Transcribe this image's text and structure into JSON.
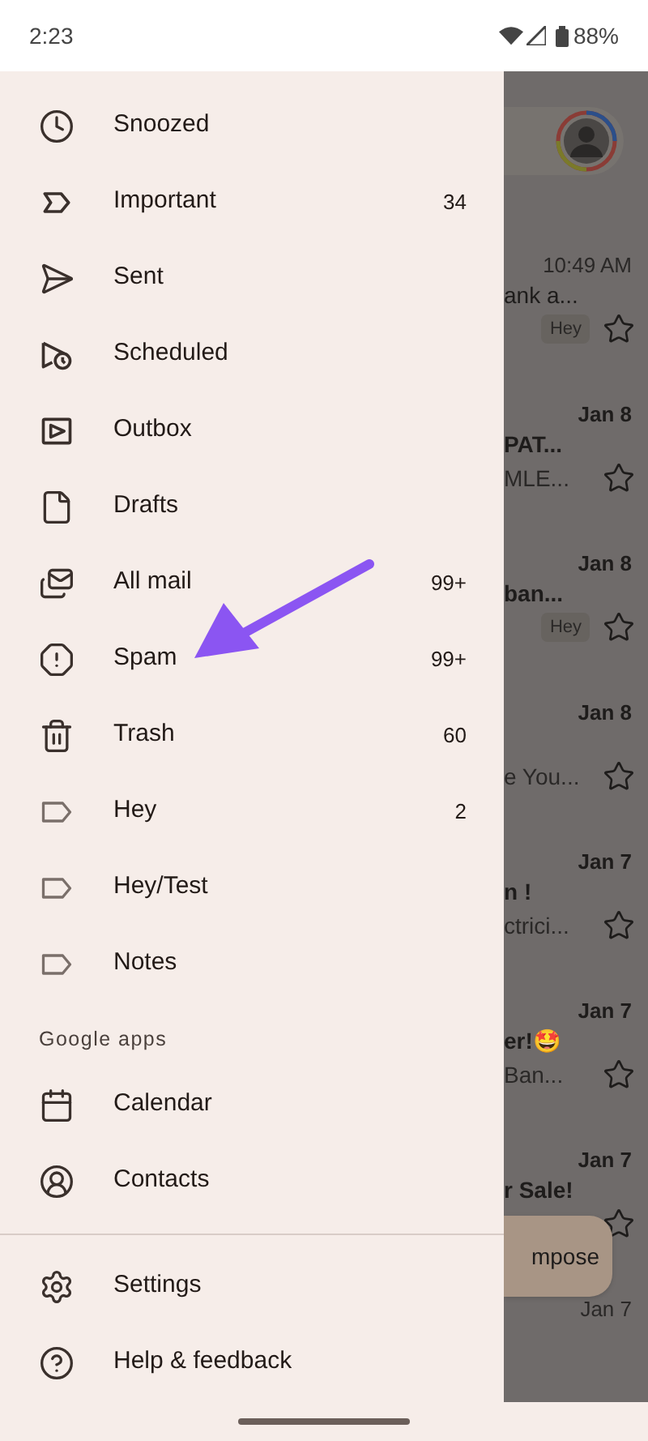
{
  "status_bar": {
    "time": "2:23",
    "battery": "88%"
  },
  "drawer": {
    "items": [
      {
        "label": "Snoozed"
      },
      {
        "label": "Important",
        "count": "34"
      },
      {
        "label": "Sent"
      },
      {
        "label": "Scheduled"
      },
      {
        "label": "Outbox"
      },
      {
        "label": "Drafts"
      },
      {
        "label": "All mail",
        "count": "99+"
      },
      {
        "label": "Spam",
        "count": "99+"
      },
      {
        "label": "Trash",
        "count": "60"
      },
      {
        "label": "Hey",
        "count": "2"
      },
      {
        "label": "Hey/Test"
      },
      {
        "label": "Notes"
      }
    ],
    "section_title": "Google apps",
    "apps": [
      {
        "label": "Calendar"
      },
      {
        "label": "Contacts"
      }
    ],
    "footer": [
      {
        "label": "Settings"
      },
      {
        "label": "Help & feedback"
      }
    ]
  },
  "inbox_behind": {
    "rows": [
      {
        "date": "10:49 AM",
        "unread": false,
        "subject": "ank a...",
        "chip": "Hey"
      },
      {
        "date": "Jan 8",
        "unread": true,
        "subject": "PAT...",
        "snippet": "MLE..."
      },
      {
        "date": "Jan 8",
        "unread": true,
        "subject": "ban...",
        "chip": "Hey"
      },
      {
        "date": "Jan 8",
        "unread": true,
        "snippet": "e You..."
      },
      {
        "date": "Jan 7",
        "unread": true,
        "subject": "n !",
        "snippet": "ctrici..."
      },
      {
        "date": "Jan 7",
        "unread": true,
        "subject": "er!🤩",
        "snippet": "Ban..."
      },
      {
        "date": "Jan 7",
        "unread": true,
        "subject": "r Sale!"
      },
      {
        "date": "Jan 7",
        "unread": false
      }
    ],
    "compose": "mpose"
  }
}
